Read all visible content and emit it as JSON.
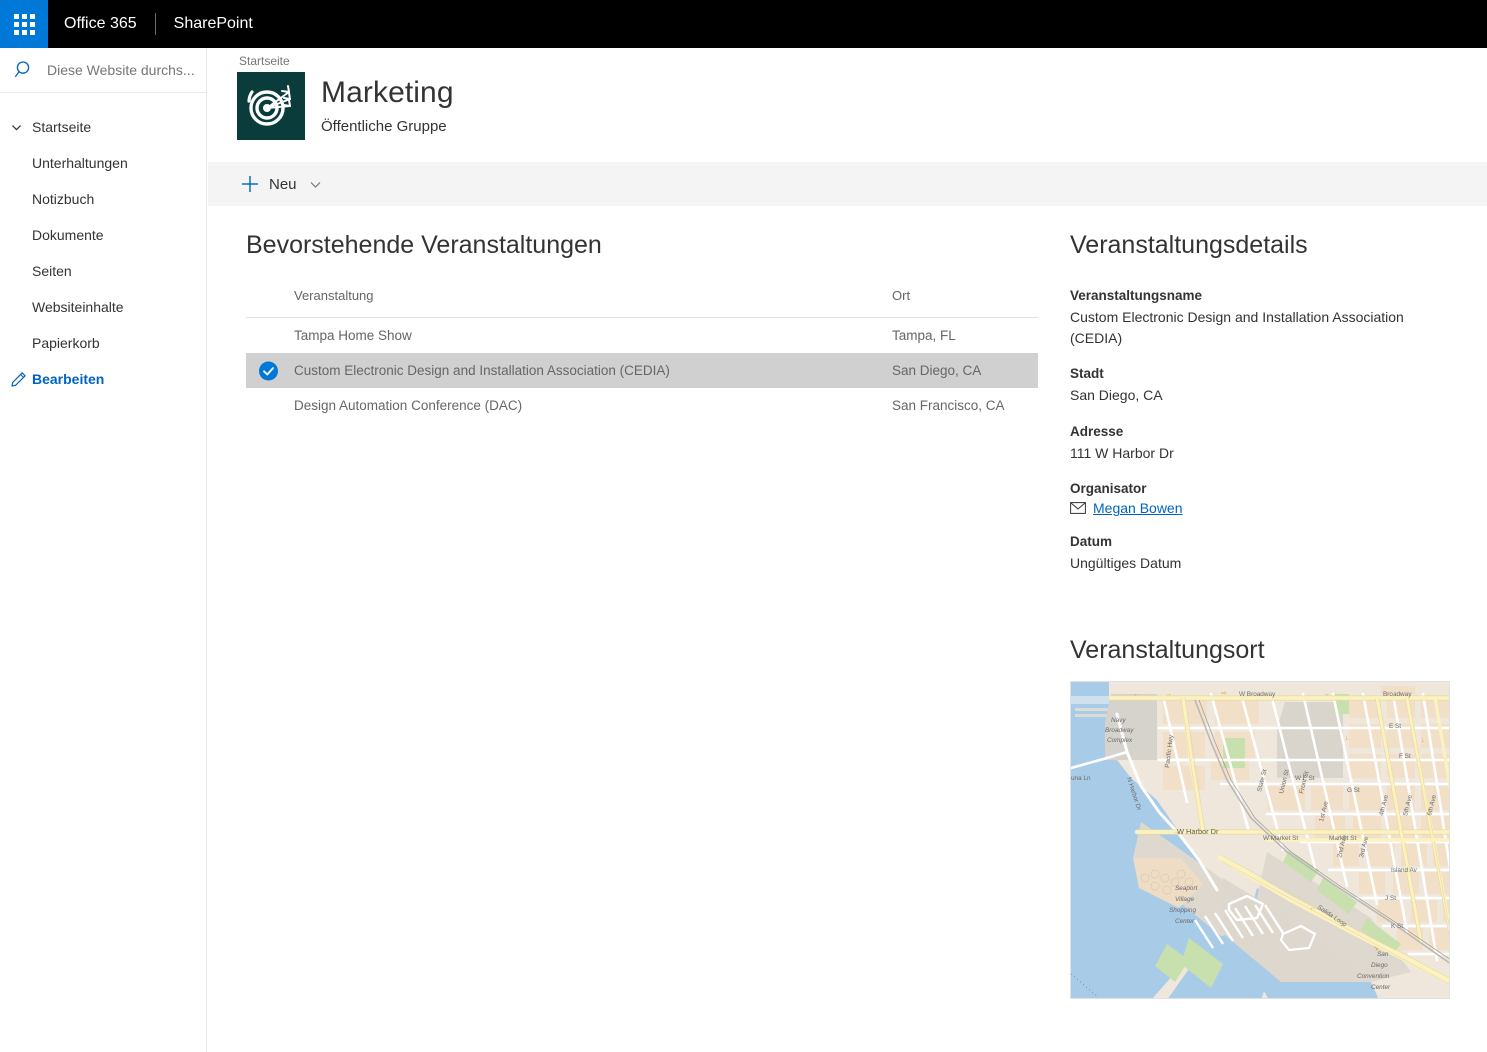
{
  "suite": {
    "waffle_icon": "app-launcher-waffle-icon",
    "brand": "Office 365",
    "app": "SharePoint"
  },
  "search": {
    "icon": "search-icon",
    "placeholder": "Diese Website durchs...",
    "value": ""
  },
  "sidebar": {
    "items": [
      {
        "label": "Startseite",
        "icon": "chevron-down-icon",
        "level": "top"
      },
      {
        "label": "Unterhaltungen",
        "level": "sub"
      },
      {
        "label": "Notizbuch",
        "level": "sub"
      },
      {
        "label": "Dokumente",
        "level": "sub"
      },
      {
        "label": "Seiten",
        "level": "sub"
      },
      {
        "label": "Websiteinhalte",
        "level": "sub"
      },
      {
        "label": "Papierkorb",
        "level": "sub"
      }
    ],
    "edit": {
      "label": "Bearbeiten",
      "icon": "pencil-icon",
      "color": "#0064bf"
    }
  },
  "site_header": {
    "breadcrumb": "Startseite",
    "title": "Marketing",
    "subtitle": "Öffentliche Gruppe",
    "logo_icon": "target-with-arrows-icon",
    "logo_background": "#0b3c3c"
  },
  "command_bar": {
    "new_label": "Neu",
    "plus_icon": "plus-icon",
    "chevron_icon": "chevron-down-icon",
    "accent": "#0064bf"
  },
  "events": {
    "title": "Bevorstehende Veranstaltungen",
    "columns": {
      "name": "Veranstaltung",
      "location": "Ort"
    },
    "rows": [
      {
        "name": "Tampa Home Show",
        "location": "Tampa, FL",
        "selected": false
      },
      {
        "name": "Custom Electronic Design and Installation Association (CEDIA)",
        "location": "San Diego, CA",
        "selected": true
      },
      {
        "name": "Design Automation Conference (DAC)",
        "location": "San Francisco, CA",
        "selected": false
      }
    ],
    "selected_row_color": "#d0d0d0",
    "check_icon": "check-circle-icon"
  },
  "details": {
    "title": "Veranstaltungsdetails",
    "fields": [
      {
        "label": "Veranstaltungsname",
        "value": "Custom Electronic Design and Installation Association (CEDIA)"
      },
      {
        "label": "Stadt",
        "value": "San Diego, CA"
      },
      {
        "label": "Adresse",
        "value": "111 W Harbor Dr"
      }
    ],
    "organizer": {
      "label": "Organisator",
      "name": "Megan Bowen",
      "icon": "mail-envelope-icon"
    },
    "date": {
      "label": "Datum",
      "value": "Ungültiges Datum"
    }
  },
  "venue": {
    "title": "Veranstaltungsort",
    "map": {
      "labels": [
        "W Broadway",
        "Broadway",
        "Navy Broadway Complex",
        "N Harbor Dr",
        "Pacific Hwy",
        "una Ln",
        "W Harbor Dr",
        "W Market St",
        "Market St",
        "W F St",
        "E St",
        "F St",
        "G St",
        "State St",
        "Union St",
        "Front St",
        "1st Ave",
        "2nd Ave",
        "3rd Ave",
        "4th Ave",
        "5th Ave",
        "6th Ave",
        "Island Ave",
        "J St",
        "K St",
        "Salida Loop",
        "Seaport Village Shopping Center",
        "San Diego Convention Center"
      ],
      "water_color": "#a8cbe8",
      "land_color": "#efe7db",
      "block_color": "#f2dfc8",
      "road_color": "#ffffff",
      "highway_color": "#fbf2c0",
      "park_color": "#c8dfae"
    }
  }
}
